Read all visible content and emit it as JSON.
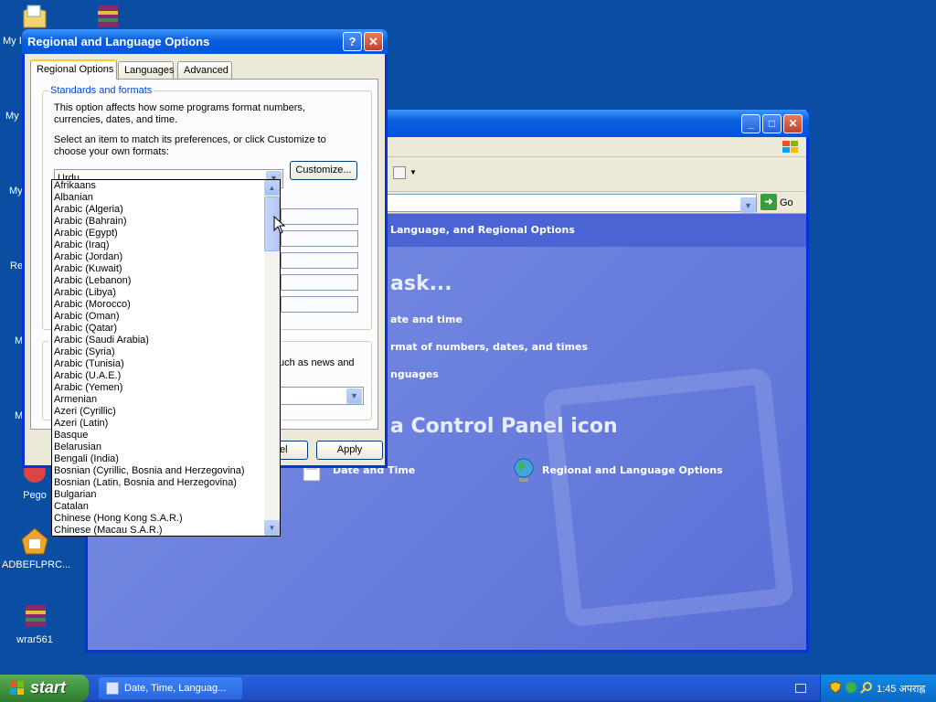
{
  "desktop": {
    "icons": [
      {
        "label": "My I",
        "name": "desktop-icon-my-documents"
      },
      {
        "label": "My",
        "name": "desktop-icon-my-computer"
      },
      {
        "label": "My",
        "name": "desktop-icon-my-network"
      },
      {
        "label": "Re",
        "name": "desktop-icon-recycle-bin"
      },
      {
        "label": "M",
        "name": "desktop-icon-m1"
      },
      {
        "label": "M",
        "name": "desktop-icon-m2"
      },
      {
        "label": "Pego",
        "name": "desktop-icon-pego"
      },
      {
        "label": "ADBEFLPRC...",
        "name": "desktop-icon-adbeflprc"
      },
      {
        "label": "wrar561",
        "name": "desktop-icon-wrar561"
      }
    ]
  },
  "control_panel": {
    "go_label": "Go",
    "breadcrumb": "Language, and Regional Options",
    "pick_task": "ask...",
    "tasks": [
      "ate and time",
      "rmat of numbers, dates, and times",
      "nguages"
    ],
    "pick_icon": "a Control Panel icon",
    "icons": [
      "Date and Time",
      "Regional and Language Options"
    ]
  },
  "dialog": {
    "title": "Regional and Language Options",
    "help_label": "?",
    "tabs": [
      "Regional Options",
      "Languages",
      "Advanced"
    ],
    "standards_group_title": "Standards and formats",
    "standards_desc": "This option affects how some programs format numbers, currencies, dates, and time.",
    "select_desc": "Select an item to match its preferences, or click Customize to choose your own formats:",
    "selected_locale": "Urdu",
    "customize_label": "Customize...",
    "location_group_title": "L",
    "location_desc": "uch as news and",
    "cancel_label": "el",
    "apply_label": "Apply"
  },
  "locale_list": [
    "Afrikaans",
    "Albanian",
    "Arabic (Algeria)",
    "Arabic (Bahrain)",
    "Arabic (Egypt)",
    "Arabic (Iraq)",
    "Arabic (Jordan)",
    "Arabic (Kuwait)",
    "Arabic (Lebanon)",
    "Arabic (Libya)",
    "Arabic (Morocco)",
    "Arabic (Oman)",
    "Arabic (Qatar)",
    "Arabic (Saudi Arabia)",
    "Arabic (Syria)",
    "Arabic (Tunisia)",
    "Arabic (U.A.E.)",
    "Arabic (Yemen)",
    "Armenian",
    "Azeri (Cyrillic)",
    "Azeri (Latin)",
    "Basque",
    "Belarusian",
    "Bengali (India)",
    "Bosnian (Cyrillic, Bosnia and Herzegovina)",
    "Bosnian (Latin, Bosnia and Herzegovina)",
    "Bulgarian",
    "Catalan",
    "Chinese (Hong Kong S.A.R.)",
    "Chinese (Macau S.A.R.)"
  ],
  "taskbar": {
    "start_label": "start",
    "task_label": "Date, Time, Languag...",
    "clock": "1:45 अपराह्न"
  },
  "colors": {
    "desktop": "#0a4ea3",
    "titlebar": "#0054e3",
    "dialog_bg": "#ece9d8",
    "group_title": "#0046d5"
  }
}
